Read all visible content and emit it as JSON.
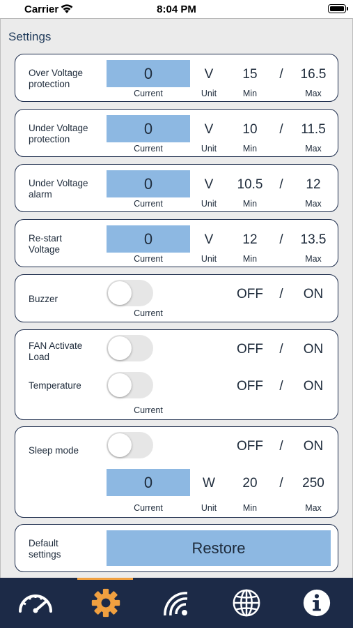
{
  "status_bar": {
    "carrier": "Carrier",
    "time": "8:04 PM"
  },
  "page": {
    "title": "Settings"
  },
  "captions": {
    "current": "Current",
    "unit": "Unit",
    "min": "Min",
    "max": "Max"
  },
  "separator": "/",
  "cards": {
    "over_voltage": {
      "label": "Over Voltage protection",
      "current": "0",
      "unit": "V",
      "min": "15",
      "max": "16.5"
    },
    "under_voltage": {
      "label": "Under Voltage protection",
      "current": "0",
      "unit": "V",
      "min": "10",
      "max": "11.5"
    },
    "under_voltage_alarm": {
      "label": "Under Voltage alarm",
      "current": "0",
      "unit": "V",
      "min": "10.5",
      "max": "12"
    },
    "restart_voltage": {
      "label": "Re-start Voltage",
      "current": "0",
      "unit": "V",
      "min": "12",
      "max": "13.5"
    },
    "buzzer": {
      "label": "Buzzer",
      "off_label": "OFF",
      "on_label": "ON",
      "state": "off"
    },
    "fan": {
      "load_label": "FAN Activate Load",
      "load_off": "OFF",
      "load_on": "ON",
      "load_state": "off",
      "temp_label": "Temperature",
      "temp_off": "OFF",
      "temp_on": "ON",
      "temp_state": "off"
    },
    "sleep_mode": {
      "label": "Sleep mode",
      "off_label": "OFF",
      "on_label": "ON",
      "state": "off",
      "current": "0",
      "unit": "W",
      "min": "20",
      "max": "250"
    },
    "default_settings": {
      "label": "Default settings",
      "button": "Restore"
    }
  },
  "tab_bar": {
    "active_tab": "settings",
    "tabs": [
      {
        "name": "gauge",
        "icon": "speedometer-icon"
      },
      {
        "name": "settings",
        "icon": "gear-icon"
      },
      {
        "name": "wireless",
        "icon": "signal-icon"
      },
      {
        "name": "web",
        "icon": "globe-icon"
      },
      {
        "name": "info",
        "icon": "info-icon"
      }
    ]
  },
  "colors": {
    "value_box": "#8db8e2",
    "tab_bar": "#1c2a47",
    "accent": "#f0a040",
    "card_border": "#1b2b4b"
  }
}
